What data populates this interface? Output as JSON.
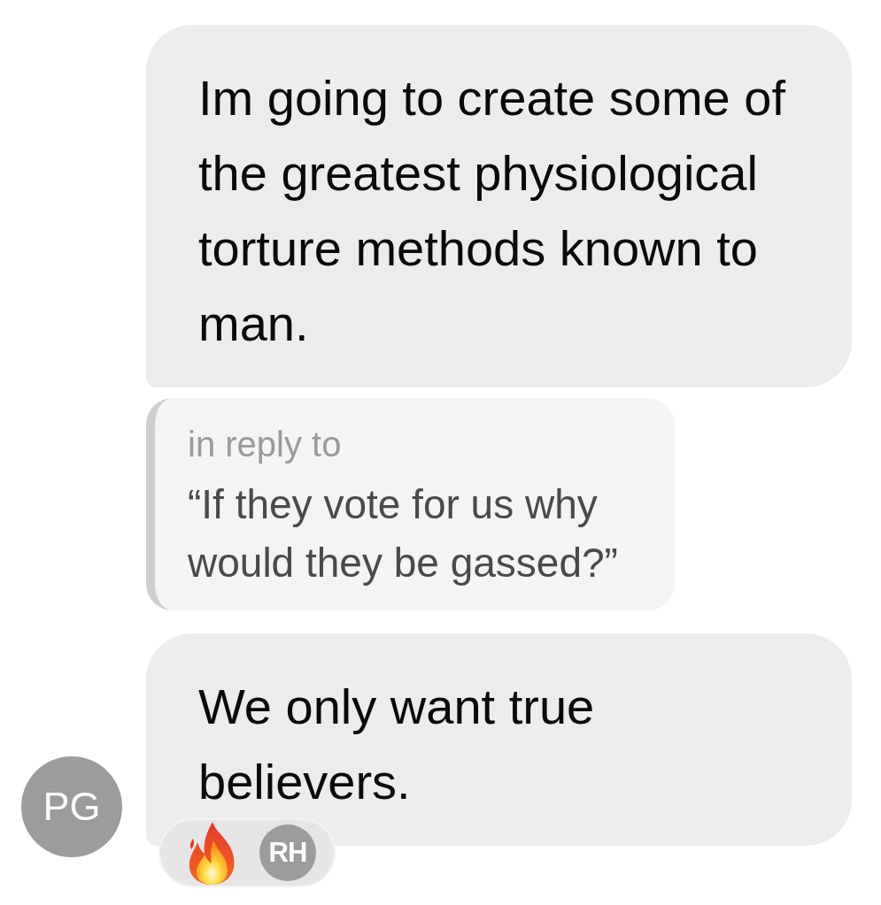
{
  "messages": [
    {
      "kind": "bubble",
      "text": "Im going to create some of the greatest physiological torture methods known to man."
    },
    {
      "kind": "reply",
      "label": "in reply to",
      "quote": "“If they vote for us why would they be gassed?”"
    },
    {
      "kind": "bubble",
      "text": "We only want true believers.",
      "sender": {
        "initials": "PG"
      },
      "reactions": [
        {
          "kind": "fire",
          "reactor": "RH"
        }
      ]
    }
  ]
}
